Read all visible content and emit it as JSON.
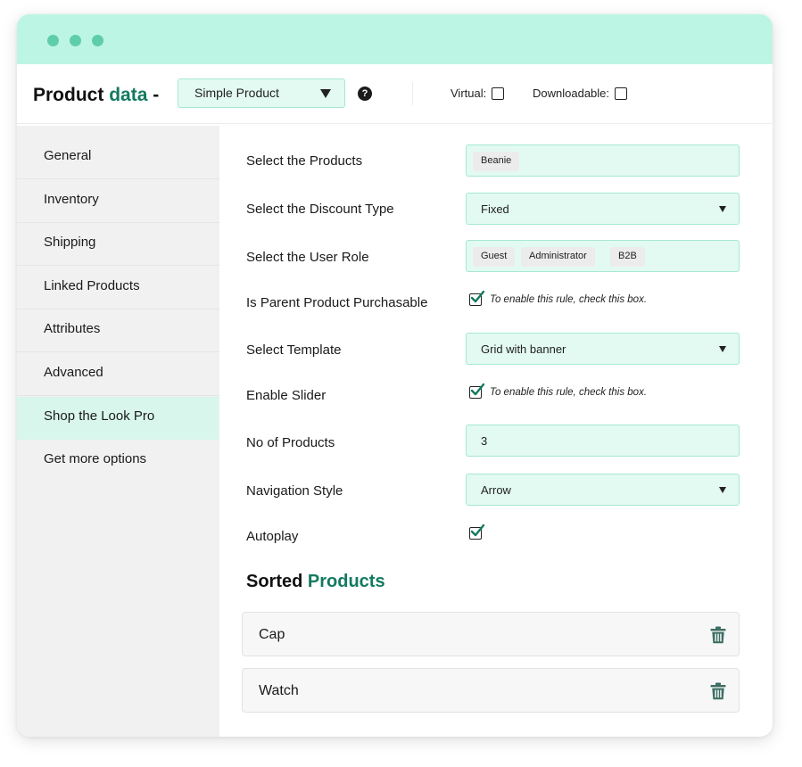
{
  "header": {
    "title_prefix": "Product",
    "title_accent": "data",
    "title_suffix": " -",
    "product_type": "Simple Product",
    "help_icon": "?",
    "virtual_label": "Virtual:",
    "downloadable_label": "Downloadable:"
  },
  "sidebar": {
    "items": [
      {
        "label": "General"
      },
      {
        "label": "Inventory"
      },
      {
        "label": "Shipping"
      },
      {
        "label": "Linked Products"
      },
      {
        "label": "Attributes"
      },
      {
        "label": "Advanced"
      },
      {
        "label": "Shop the Look Pro"
      },
      {
        "label": "Get more options"
      }
    ]
  },
  "form": {
    "products": {
      "label": "Select the Products",
      "chips": [
        "Beanie"
      ]
    },
    "discount": {
      "label": "Select the Discount Type",
      "value": "Fixed"
    },
    "roles": {
      "label": "Select the User Role",
      "chips": [
        "Guest",
        "Administrator",
        "B2B"
      ]
    },
    "parent": {
      "label": "Is Parent Product Purchasable",
      "hint": "To enable this rule, check this box.",
      "checked": true
    },
    "template": {
      "label": "Select Template",
      "value": "Grid with banner"
    },
    "slider": {
      "label": "Enable Slider",
      "hint": "To enable this rule, check this box.",
      "checked": true
    },
    "count": {
      "label": "No of Products",
      "value": "3"
    },
    "navigation": {
      "label": "Navigation Style",
      "value": "Arrow"
    },
    "autoplay": {
      "label": "Autoplay",
      "checked": true
    }
  },
  "sorted": {
    "title_prefix": "Sorted",
    "title_accent": "Products",
    "items": [
      {
        "name": "Cap",
        "icon": "trash-icon"
      },
      {
        "name": "Watch",
        "icon": "trash-icon"
      }
    ]
  },
  "colors": {
    "accent": "#127a60",
    "titlebar": "#bdf5e4",
    "dot": "#5fcdaa",
    "field_bg": "#e2faf2",
    "field_border": "#a6e8d2",
    "active_item": "#d8f6ec",
    "sidebar_bg": "#f1f1f1"
  }
}
